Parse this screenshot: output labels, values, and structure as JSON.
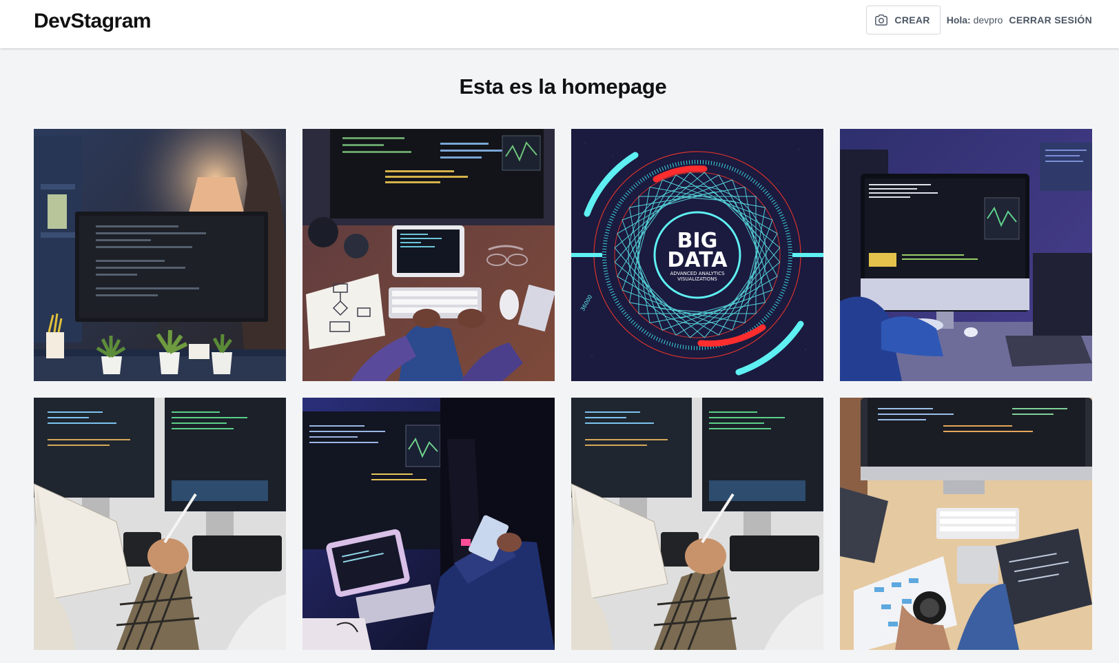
{
  "header": {
    "logo": "DevStagram",
    "create_label": "CREAR",
    "greeting_prefix": "Hola:",
    "username": "devpro",
    "logout_label": "CERRAR SESIÓN",
    "create_icon": "camera-icon"
  },
  "main": {
    "title": "Esta es la homepage"
  },
  "posts": [
    {
      "alt": "Developer workspace with monitor showing code, lamp and plants"
    },
    {
      "alt": "Overhead view of developer typing on keyboard with flowchart sketch"
    },
    {
      "alt": "Big Data advanced analytics visualizations graphic",
      "text_title": "BIG DATA",
      "text_sub1": "ADVANCED ANALYTICS",
      "text_sub2": "VISUALIZATIONS",
      "text_num": "36000"
    },
    {
      "alt": "Developer at desktop computer with code on screen"
    },
    {
      "alt": "Two monitors with code, person holding notebook and pen"
    },
    {
      "alt": "Programmer with tablet and smartphone at night"
    },
    {
      "alt": "Two monitors with code, person holding notebook and pen"
    },
    {
      "alt": "Top-down view of desk with iMac, keyboard, diagrams and coffee"
    }
  ],
  "colors": {
    "background": "#f3f4f6",
    "header_bg": "#ffffff",
    "text_dark": "#111111",
    "text_muted": "#4b5563",
    "bigdata_cyan": "#5ef0f2",
    "bigdata_red": "#ff2d2d",
    "bigdata_bg": "#1b1a3f"
  }
}
